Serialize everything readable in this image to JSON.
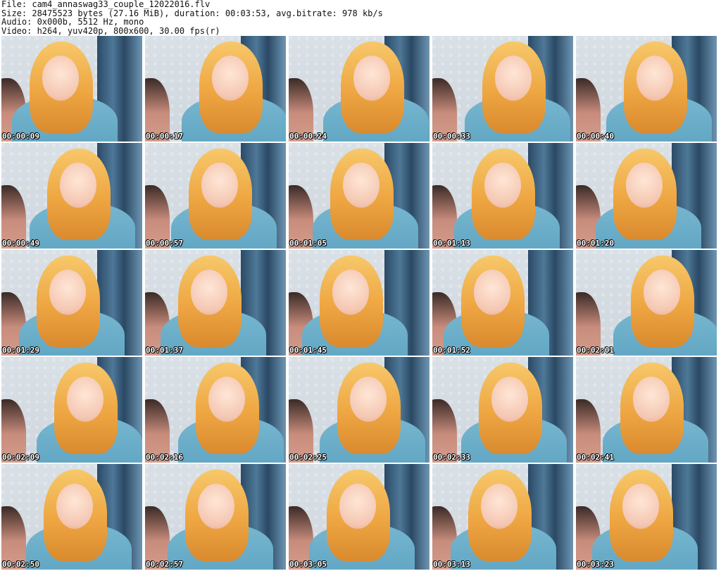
{
  "header": {
    "file_line": "File: cam4_annaswag33_couple_12022016.flv",
    "size_line": "Size: 28475523 bytes (27.16 MiB), duration: 00:03:53, avg.bitrate: 978 kb/s",
    "audio_line": "Audio: 0x000b, 5512 Hz, mono",
    "video_line": "Video: h264, yuv420p, 800x600, 30.00 fps(r)"
  },
  "thumbnails": [
    {
      "time": "00:00:09"
    },
    {
      "time": "00:00:17"
    },
    {
      "time": "00:00:24"
    },
    {
      "time": "00:00:33"
    },
    {
      "time": "00:00:40"
    },
    {
      "time": "00:00:49"
    },
    {
      "time": "00:00:57"
    },
    {
      "time": "00:01:05"
    },
    {
      "time": "00:01:13"
    },
    {
      "time": "00:01:20"
    },
    {
      "time": "00:01:29"
    },
    {
      "time": "00:01:37"
    },
    {
      "time": "00:01:45"
    },
    {
      "time": "00:01:52"
    },
    {
      "time": "00:02:01"
    },
    {
      "time": "00:02:09"
    },
    {
      "time": "00:02:16"
    },
    {
      "time": "00:02:25"
    },
    {
      "time": "00:02:33"
    },
    {
      "time": "00:02:41"
    },
    {
      "time": "00:02:50"
    },
    {
      "time": "00:02:57"
    },
    {
      "time": "00:03:05"
    },
    {
      "time": "00:03:13"
    },
    {
      "time": "00:03:23"
    }
  ],
  "colors": {
    "background": "#ffffff",
    "header_text": "#111111",
    "timestamp_text": "#ffffff",
    "timestamp_outline": "#000000"
  }
}
